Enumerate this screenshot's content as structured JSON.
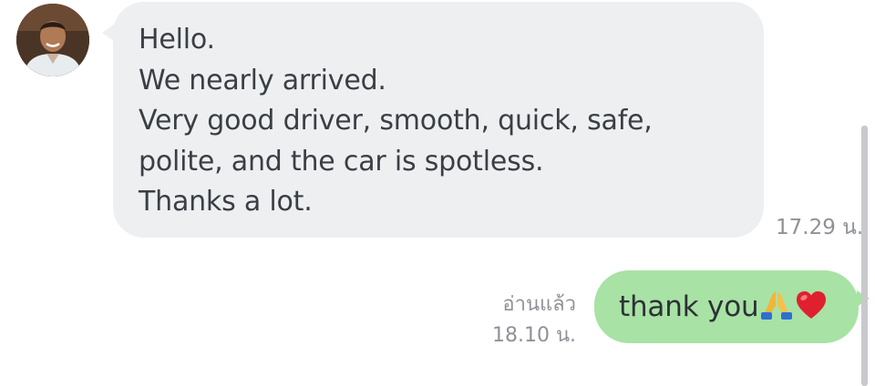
{
  "conversation": {
    "incoming": {
      "sender_avatar_icon": "profile-photo-avatar",
      "lines": [
        "Hello.",
        "We nearly arrived.",
        "Very good driver, smooth, quick, safe,",
        "polite, and the car is spotless.",
        "Thanks a lot."
      ],
      "time": "17.29 น."
    },
    "outgoing": {
      "text": "thank you",
      "emojis": [
        "folded-hands-icon",
        "red-heart-icon"
      ],
      "read_label": "อ่านแล้ว",
      "time": "18.10 น."
    }
  },
  "colors": {
    "incoming_bubble": "#eeeff1",
    "outgoing_bubble": "#a8e2a5",
    "meta_text": "#8e9297",
    "message_text": "#3a3e45"
  }
}
